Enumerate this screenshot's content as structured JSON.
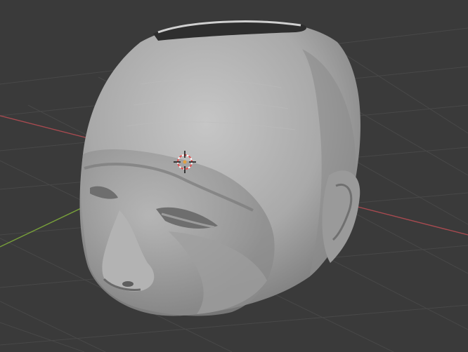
{
  "viewport": {
    "background_color": "#3a3a3a",
    "grid_color": "#4a4a4a",
    "x_axis_color": "#b04a52",
    "y_axis_color": "#7aa33a"
  },
  "scene": {
    "object": "head-mesh",
    "mesh_color": "#a8a8a8"
  },
  "cursor": {
    "icon": "3d-cursor-icon",
    "ring_colors": [
      "#e05050",
      "#ffffff"
    ]
  }
}
